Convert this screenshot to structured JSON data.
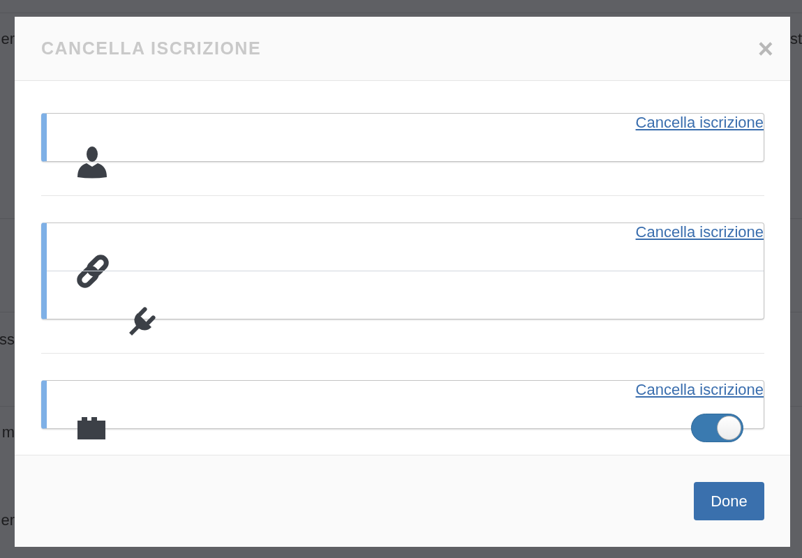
{
  "background": {
    "left_fragments": [
      "er",
      "ss",
      "m",
      "er"
    ],
    "right_fragments": [
      "st"
    ]
  },
  "dialog": {
    "title": "CANCELLA ISCRIZIONE",
    "close": "×",
    "cards": [
      {
        "link": "Cancella iscrizione",
        "rows": [
          {
            "kind": "user"
          }
        ]
      },
      {
        "link": "Cancella iscrizione",
        "rows": [
          {
            "kind": "link"
          },
          {
            "kind": "plug"
          }
        ]
      },
      {
        "link": "Cancella iscrizione",
        "rows": [
          {
            "kind": "block",
            "toggle": {
              "on": true
            }
          }
        ]
      }
    ],
    "done": "Done"
  }
}
